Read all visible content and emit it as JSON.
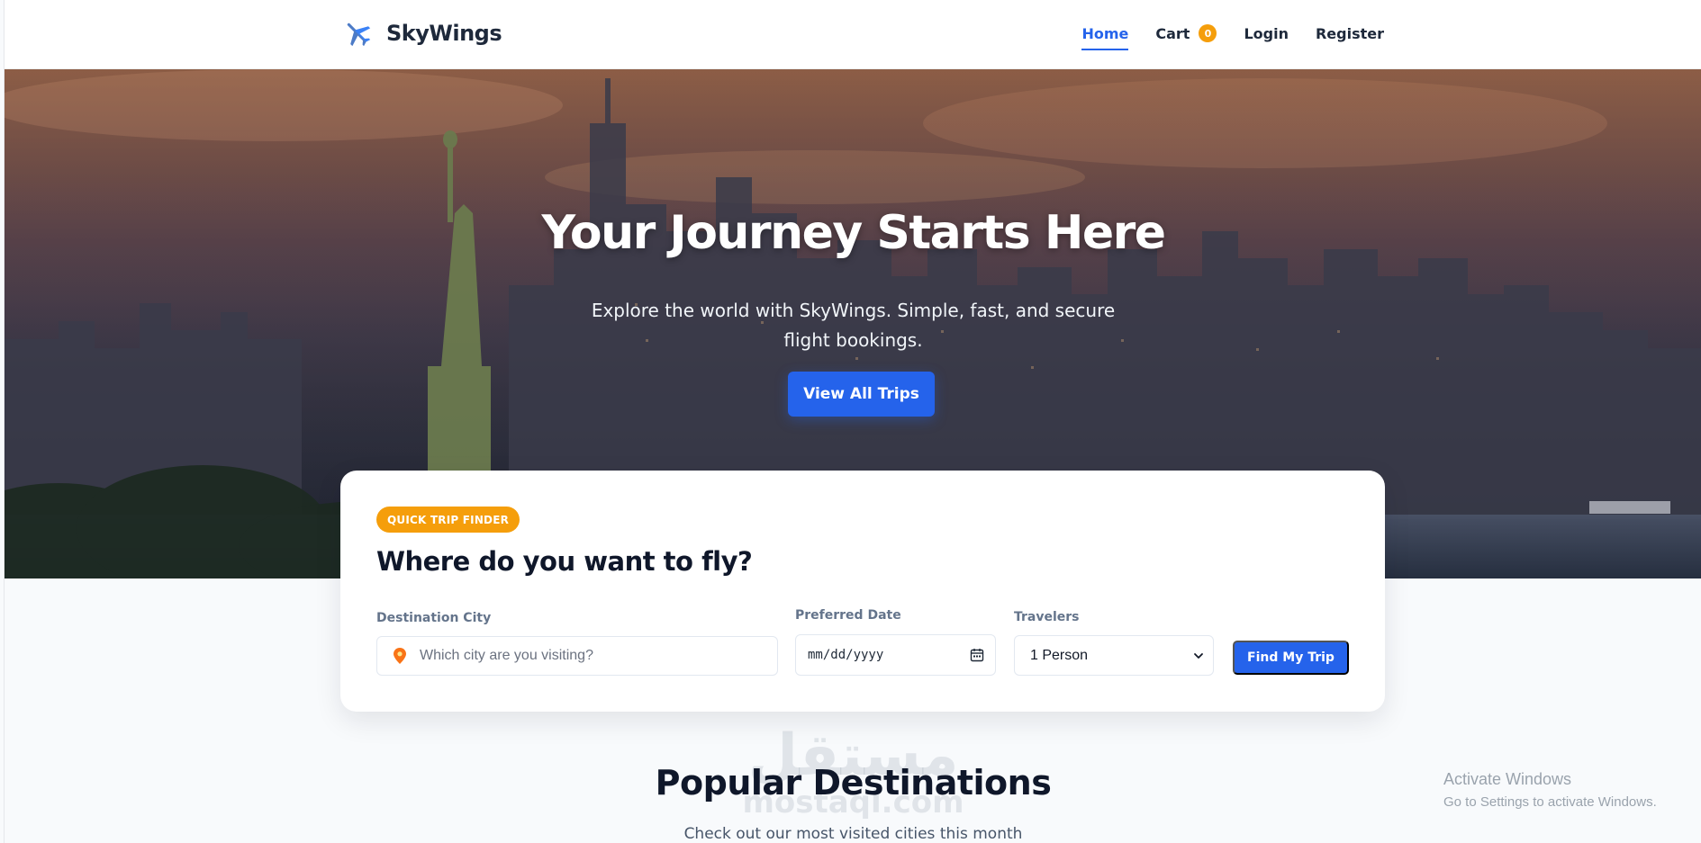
{
  "brand": {
    "name": "SkyWings",
    "icon": "airplane-icon"
  },
  "nav": {
    "home": "Home",
    "cart": "Cart",
    "cart_count": "0",
    "login": "Login",
    "register": "Register"
  },
  "hero": {
    "title": "Your Journey Starts Here",
    "subtitle_line1": "Explore the world with SkyWings. Simple, fast, and secure",
    "subtitle_line2": "flight bookings.",
    "cta": "View All Trips"
  },
  "finder": {
    "badge": "QUICK TRIP FINDER",
    "title": "Where do you want to fly?",
    "destination_label": "Destination City",
    "destination_placeholder": "Which city are you visiting?",
    "date_label": "Preferred Date",
    "date_placeholder": "mm/dd/yyyy",
    "travelers_label": "Travelers",
    "travelers_value": "1 Person",
    "submit": "Find My Trip"
  },
  "popular": {
    "title": "Popular Destinations",
    "subtitle": "Check out our most visited cities this month"
  },
  "watermark": {
    "arabic": "مستقل",
    "latin": "mostaql.com"
  },
  "os_overlay": {
    "line1": "Activate Windows",
    "line2": "Go to Settings to activate Windows."
  },
  "colors": {
    "primary": "#2563eb",
    "accent": "#f59e0b",
    "text_dark": "#0f172a"
  }
}
